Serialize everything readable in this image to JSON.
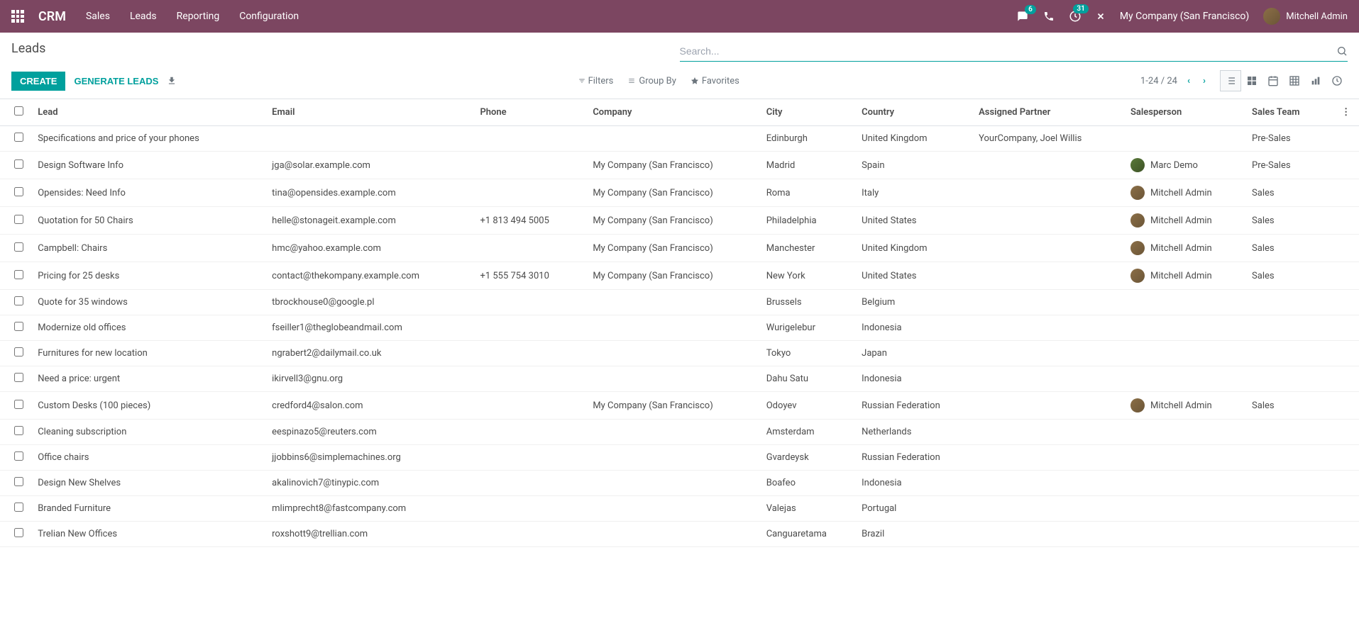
{
  "app_name": "CRM",
  "nav": [
    "Sales",
    "Leads",
    "Reporting",
    "Configuration"
  ],
  "badges": {
    "messages": "6",
    "activities": "31"
  },
  "company": "My Company (San Francisco)",
  "user": "Mitchell Admin",
  "page_title": "Leads",
  "search_placeholder": "Search...",
  "buttons": {
    "create": "CREATE",
    "generate": "GENERATE LEADS"
  },
  "toolbar": {
    "filters": "Filters",
    "groupby": "Group By",
    "favorites": "Favorites"
  },
  "pager": {
    "range": "1-24",
    "sep": "/",
    "total": "24"
  },
  "columns": {
    "lead": "Lead",
    "email": "Email",
    "phone": "Phone",
    "company": "Company",
    "city": "City",
    "country": "Country",
    "partner": "Assigned Partner",
    "salesperson": "Salesperson",
    "team": "Sales Team"
  },
  "rows": [
    {
      "lead": "Specifications and price of your phones",
      "email": "",
      "phone": "",
      "company": "",
      "city": "Edinburgh",
      "country": "United Kingdom",
      "partner": "YourCompany, Joel Willis",
      "salesperson": "",
      "team": "Pre-Sales"
    },
    {
      "lead": "Design Software Info",
      "email": "jga@solar.example.com",
      "phone": "",
      "company": "My Company (San Francisco)",
      "city": "Madrid",
      "country": "Spain",
      "partner": "",
      "salesperson": "Marc Demo",
      "team": "Pre-Sales",
      "avatar": "alt"
    },
    {
      "lead": "Opensides: Need Info",
      "email": "tina@opensides.example.com",
      "phone": "",
      "company": "My Company (San Francisco)",
      "city": "Roma",
      "country": "Italy",
      "partner": "",
      "salesperson": "Mitchell Admin",
      "team": "Sales"
    },
    {
      "lead": "Quotation for 50 Chairs",
      "email": "helle@stonageit.example.com",
      "phone": "+1 813 494 5005",
      "company": "My Company (San Francisco)",
      "city": "Philadelphia",
      "country": "United States",
      "partner": "",
      "salesperson": "Mitchell Admin",
      "team": "Sales"
    },
    {
      "lead": "Campbell: Chairs",
      "email": "hmc@yahoo.example.com",
      "phone": "",
      "company": "My Company (San Francisco)",
      "city": "Manchester",
      "country": "United Kingdom",
      "partner": "",
      "salesperson": "Mitchell Admin",
      "team": "Sales"
    },
    {
      "lead": "Pricing for 25 desks",
      "email": "contact@thekompany.example.com",
      "phone": "+1 555 754 3010",
      "company": "My Company (San Francisco)",
      "city": "New York",
      "country": "United States",
      "partner": "",
      "salesperson": "Mitchell Admin",
      "team": "Sales"
    },
    {
      "lead": "Quote for 35 windows",
      "email": "tbrockhouse0@google.pl",
      "phone": "",
      "company": "",
      "city": "Brussels",
      "country": "Belgium",
      "partner": "",
      "salesperson": "",
      "team": ""
    },
    {
      "lead": "Modernize old offices",
      "email": "fseiller1@theglobeandmail.com",
      "phone": "",
      "company": "",
      "city": "Wurigelebur",
      "country": "Indonesia",
      "partner": "",
      "salesperson": "",
      "team": ""
    },
    {
      "lead": "Furnitures for new location",
      "email": "ngrabert2@dailymail.co.uk",
      "phone": "",
      "company": "",
      "city": "Tokyo",
      "country": "Japan",
      "partner": "",
      "salesperson": "",
      "team": ""
    },
    {
      "lead": "Need a price: urgent",
      "email": "ikirvell3@gnu.org",
      "phone": "",
      "company": "",
      "city": "Dahu Satu",
      "country": "Indonesia",
      "partner": "",
      "salesperson": "",
      "team": ""
    },
    {
      "lead": "Custom Desks (100 pieces)",
      "email": "credford4@salon.com",
      "phone": "",
      "company": "My Company (San Francisco)",
      "city": "Odoyev",
      "country": "Russian Federation",
      "partner": "",
      "salesperson": "Mitchell Admin",
      "team": "Sales"
    },
    {
      "lead": "Cleaning subscription",
      "email": "eespinazo5@reuters.com",
      "phone": "",
      "company": "",
      "city": "Amsterdam",
      "country": "Netherlands",
      "partner": "",
      "salesperson": "",
      "team": ""
    },
    {
      "lead": "Office chairs",
      "email": "jjobbins6@simplemachines.org",
      "phone": "",
      "company": "",
      "city": "Gvardeysk",
      "country": "Russian Federation",
      "partner": "",
      "salesperson": "",
      "team": ""
    },
    {
      "lead": "Design New Shelves",
      "email": "akalinovich7@tinypic.com",
      "phone": "",
      "company": "",
      "city": "Boafeo",
      "country": "Indonesia",
      "partner": "",
      "salesperson": "",
      "team": ""
    },
    {
      "lead": "Branded Furniture",
      "email": "mlimprecht8@fastcompany.com",
      "phone": "",
      "company": "",
      "city": "Valejas",
      "country": "Portugal",
      "partner": "",
      "salesperson": "",
      "team": ""
    },
    {
      "lead": "Trelian New Offices",
      "email": "roxshott9@trellian.com",
      "phone": "",
      "company": "",
      "city": "Canguaretama",
      "country": "Brazil",
      "partner": "",
      "salesperson": "",
      "team": ""
    }
  ]
}
